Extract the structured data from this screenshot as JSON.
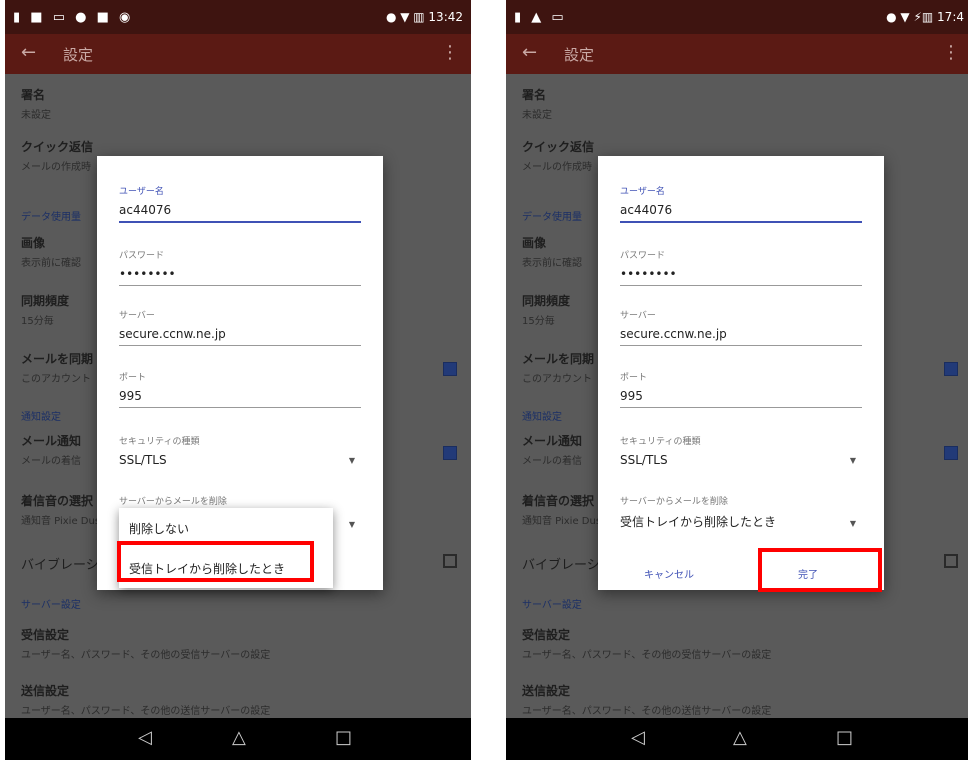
{
  "status_left_icons": "▮ ■ ▭ ● ■ ◉",
  "status_right_left_phone": "● ▼ ▥ 13:42",
  "status_right_right_phone": "● ▼ ⚡▥ 17:4",
  "status_left_icons_right_phone": "▮ ▲ ▭",
  "appbar": {
    "back_icon": "←",
    "title": "設定",
    "menu_icon": "⋮"
  },
  "settings": {
    "signature_title": "署名",
    "signature_sub": "未設定",
    "quick_reply_title": "クイック返信",
    "quick_reply_sub": "メールの作成時",
    "data_section": "データ使用量",
    "images_title": "画像",
    "images_sub": "表示前に確認",
    "sync_freq_title": "同期頻度",
    "sync_freq_sub": "15分毎",
    "sync_mail_title": "メールを同期",
    "sync_mail_sub": "このアカウント",
    "notify_section": "通知設定",
    "notify_title": "メール通知",
    "notify_sub": "メールの着信",
    "ringtone_title": "着信音の選択",
    "ringtone_sub": "通知音 Pixie Dust",
    "vibrate_title": "バイブレーション",
    "server_section": "サーバー設定",
    "incoming_title": "受信設定",
    "incoming_sub": "ユーザー名、パスワード、その他の受信サーバーの設定",
    "outgoing_title": "送信設定",
    "outgoing_sub": "ユーザー名、パスワード、その他の送信サーバーの設定"
  },
  "dialog": {
    "username_label": "ユーザー名",
    "username_value": "ac44076",
    "password_label": "パスワード",
    "password_value": "••••••••",
    "server_label": "サーバー",
    "server_value": "secure.ccnw.ne.jp",
    "port_label": "ポート",
    "port_value": "995",
    "security_label": "セキュリティの種類",
    "security_value": "SSL/TLS",
    "delete_label": "サーバーからメールを削除",
    "delete_value_selected": "受信トレイから削除したとき",
    "cancel_label": "キャンセル",
    "done_label": "完了"
  },
  "popup": {
    "option_1": "削除しない",
    "option_2": "受信トレイから削除したとき"
  },
  "navbar": {
    "back_icon": "◁",
    "home_icon": "△",
    "recent_icon": "□"
  }
}
